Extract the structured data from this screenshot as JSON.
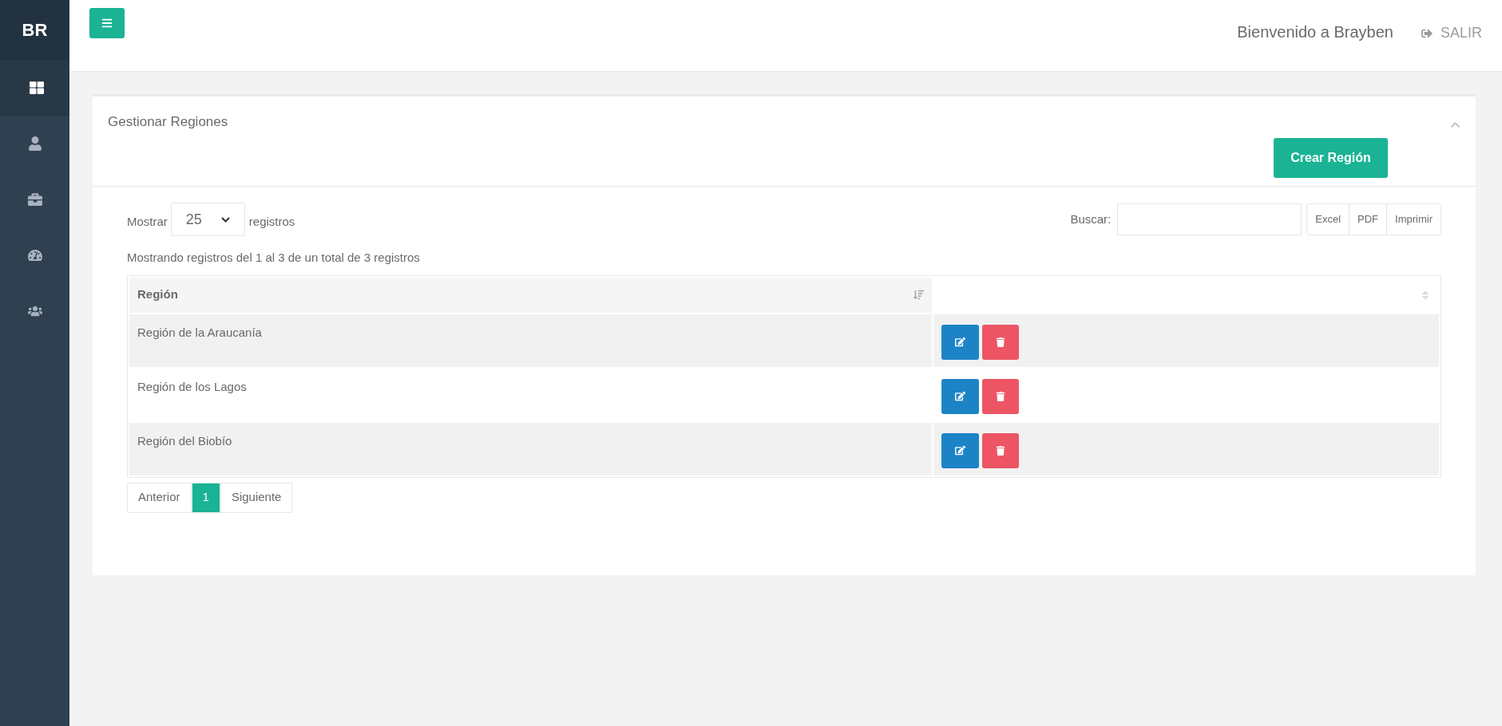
{
  "sidebar": {
    "logo": "BR",
    "items": [
      {
        "kind": "dashboard",
        "selected": true
      },
      {
        "kind": "user",
        "selected": false
      },
      {
        "kind": "briefcase",
        "selected": false
      },
      {
        "kind": "gauge",
        "selected": false
      },
      {
        "kind": "users",
        "selected": false
      }
    ]
  },
  "header": {
    "welcome": "Bienvenido a Brayben",
    "logout": "SALIR"
  },
  "panel": {
    "title": "Gestionar Regiones",
    "create_button": "Crear Región",
    "length": {
      "before": "Mostrar",
      "value": "25",
      "after": "registros"
    },
    "search": {
      "label": "Buscar:"
    },
    "export_buttons": [
      "Excel",
      "PDF",
      "Imprimir"
    ],
    "info": "Mostrando registros del 1 al 3 de un total de 3 registros",
    "table": {
      "columns": [
        {
          "label": "Región",
          "sorted": true
        },
        {
          "sorted": false
        }
      ],
      "rows": [
        {
          "region": "Región de la Araucanía"
        },
        {
          "region": "Región de los Lagos"
        },
        {
          "region": "Región del Biobío"
        }
      ]
    },
    "pagination": [
      {
        "label": "Anterior",
        "selected": false
      },
      {
        "label": "1",
        "selected": true
      },
      {
        "label": "Siguiente",
        "selected": false
      }
    ]
  }
}
